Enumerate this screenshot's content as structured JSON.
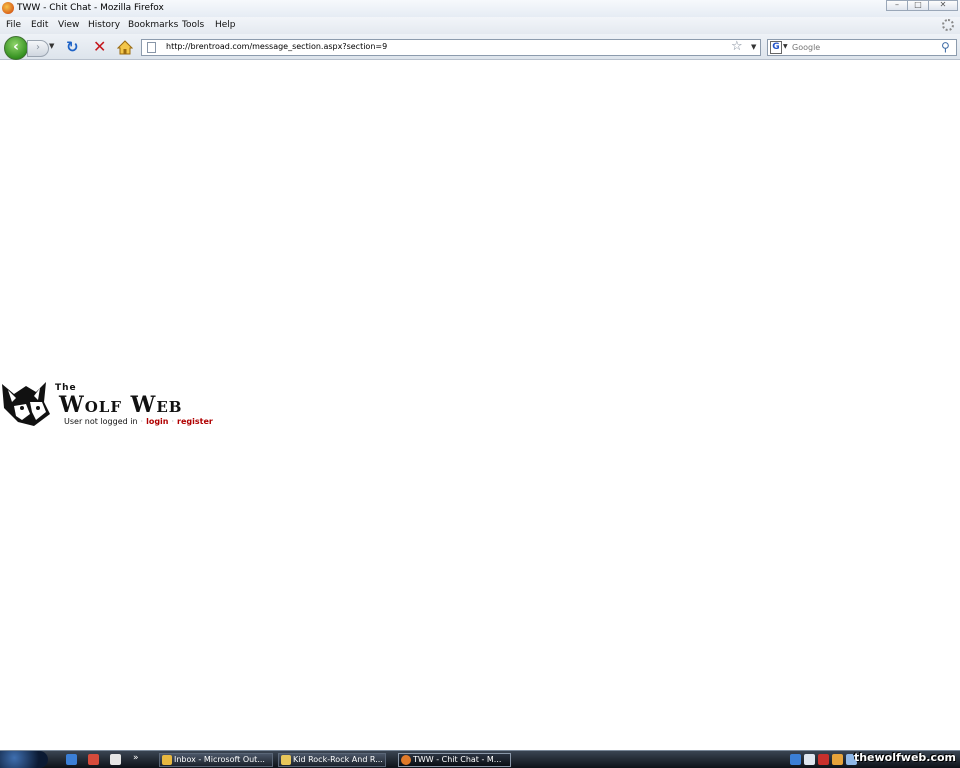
{
  "window": {
    "title": "TWW - Chit Chat - Mozilla Firefox",
    "minimize_glyph": "–",
    "maximize_glyph": "□",
    "close_glyph": "✕"
  },
  "menubar": {
    "items": [
      "File",
      "Edit",
      "View",
      "History",
      "Bookmarks",
      "Tools",
      "Help"
    ]
  },
  "navbar": {
    "back_glyph": "‹",
    "forward_glyph": "›",
    "dropdown_glyph": "▼",
    "reload_glyph": "↻",
    "stop_glyph": "✕",
    "url": "http://brentroad.com/message_section.aspx?section=9",
    "star_glyph": "☆",
    "search_engine_glyph": "G",
    "search_placeholder": "Google",
    "search_glyph": "⚲"
  },
  "page": {
    "logo_the": "The",
    "logo_brand": "Wolf Web",
    "status_text": "User not logged in",
    "separator": "·",
    "login_label": "login",
    "register_label": "register"
  },
  "taskbar": {
    "items": [
      "Inbox - Microsoft Out...",
      "Kid Rock-Rock And R...",
      "TWW - Chit Chat - M..."
    ],
    "overflow_glyph": "»",
    "active_index": 2
  },
  "watermark": "thewolfweb.com",
  "colors": {
    "link_red": "#b00000",
    "reload_blue": "#1e63c7",
    "stop_red": "#c4171d",
    "back_green": "#2f8d1c"
  }
}
